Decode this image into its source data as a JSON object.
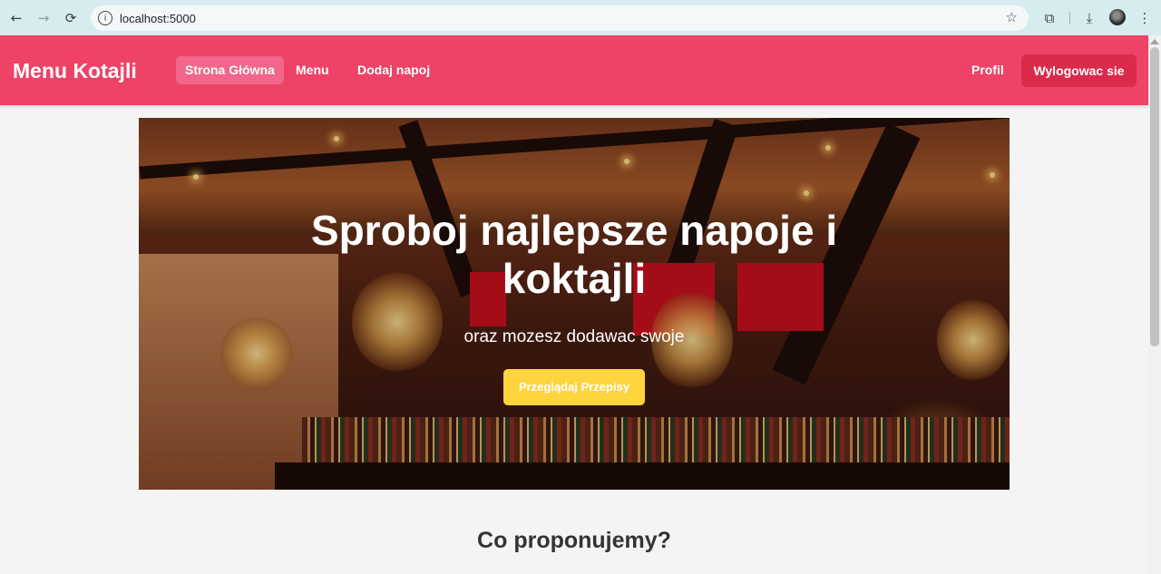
{
  "browser": {
    "url": "localhost:5000",
    "icons": {
      "back": "arrow-left",
      "forward": "arrow-right",
      "reload": "reload",
      "site_info": "info",
      "bookmark": "star",
      "extensions": "puzzle",
      "downloads": "download",
      "profile": "avatar",
      "menu": "kebab"
    }
  },
  "navbar": {
    "brand": "Menu Kotajli",
    "links": [
      {
        "label": "Strona Główna",
        "active": true
      },
      {
        "label": "Menu",
        "active": false
      },
      {
        "label": "Dodaj napoj",
        "active": false
      }
    ],
    "profile_label": "Profil",
    "logout_label": "Wylogowac sie",
    "color": "#ee4266",
    "logout_color": "#db2a4a"
  },
  "hero": {
    "title": "Sproboj najlepsze napoje i koktajli",
    "subtitle": "oraz mozesz dodawac swoje",
    "button_label": "Przeglądaj Przepisy",
    "button_color": "#fed43f"
  },
  "section": {
    "title": "Co proponujemy?"
  }
}
